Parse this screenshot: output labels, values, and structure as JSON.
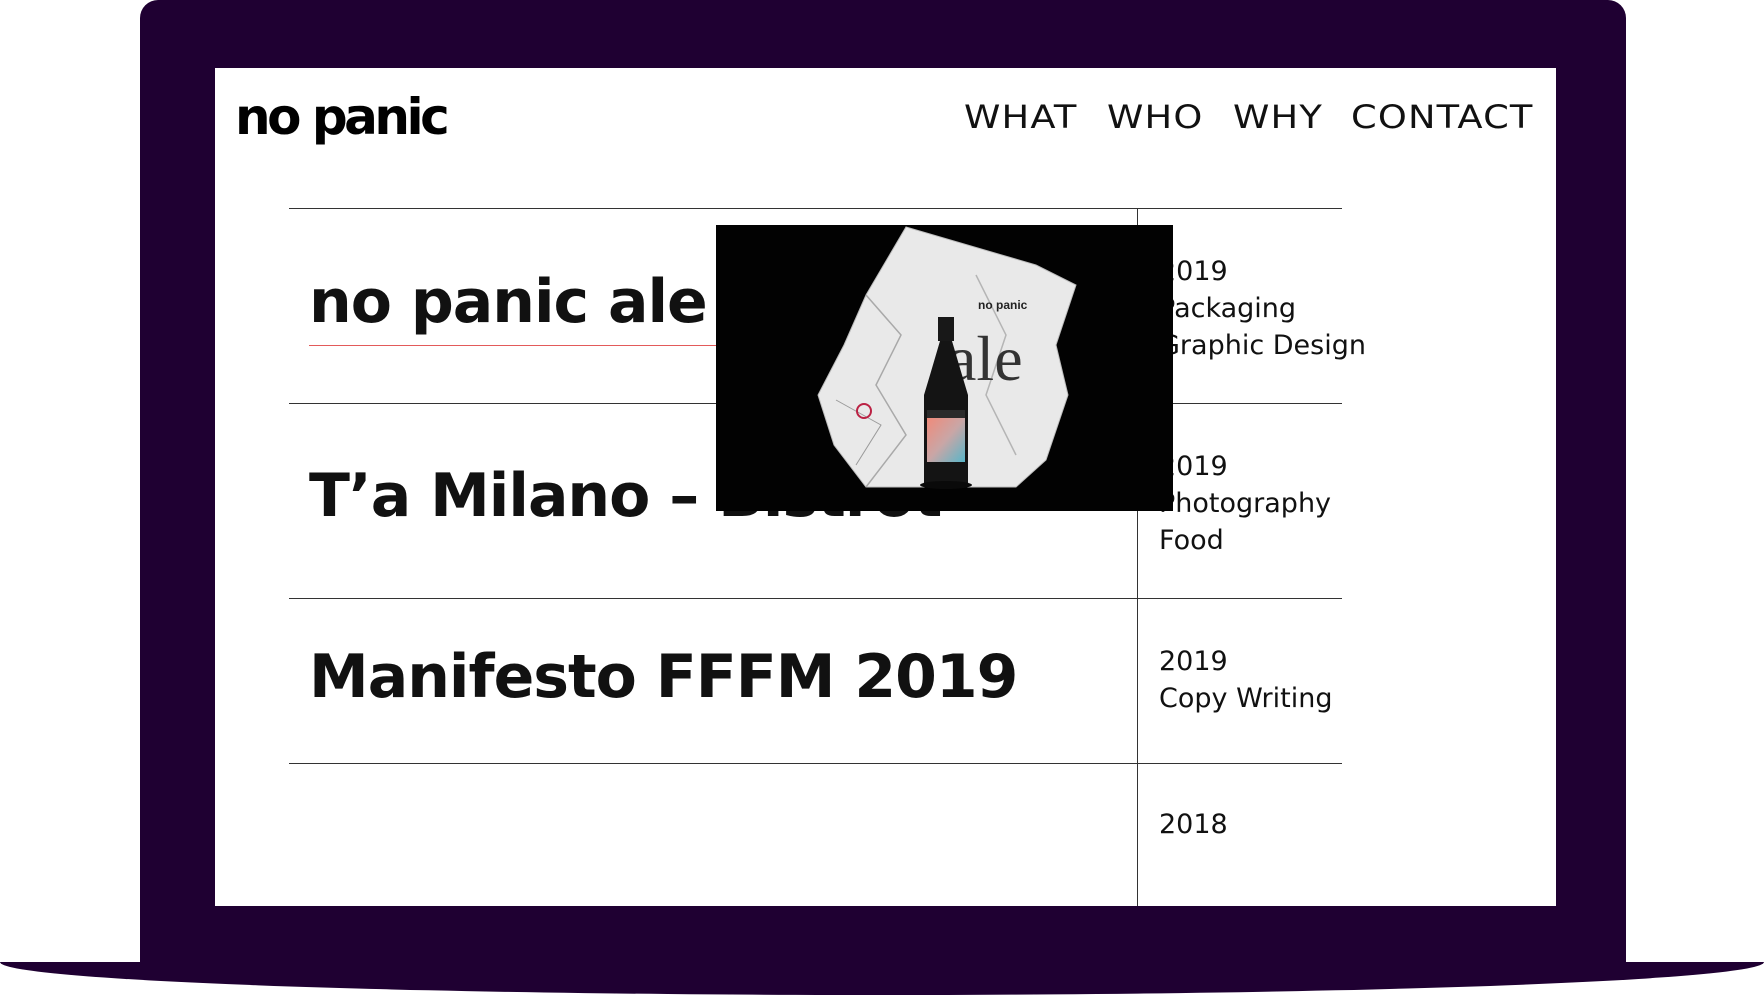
{
  "site": {
    "logo": "no panic"
  },
  "nav": {
    "items": [
      "WHAT",
      "WHO",
      "WHY",
      "CONTACT"
    ]
  },
  "projects": [
    {
      "title": "no panic ale",
      "meta": [
        "2019",
        "Packaging",
        "Graphic Design"
      ]
    },
    {
      "title": "T’a Milano – Bistrot",
      "meta": [
        "2019",
        "Photography",
        "Food"
      ]
    },
    {
      "title": "Manifesto FFFM 2019",
      "meta": [
        "2019",
        "Copy Writing"
      ]
    },
    {
      "title": "",
      "meta": [
        "2018"
      ]
    }
  ],
  "preview": {
    "bag_text": "ale",
    "bag_brand": "no panic",
    "icon": "beer-bottle-photo"
  },
  "colors": {
    "frame": "#1f0032",
    "accent_underline": "#e35a5a",
    "text": "#111111"
  }
}
